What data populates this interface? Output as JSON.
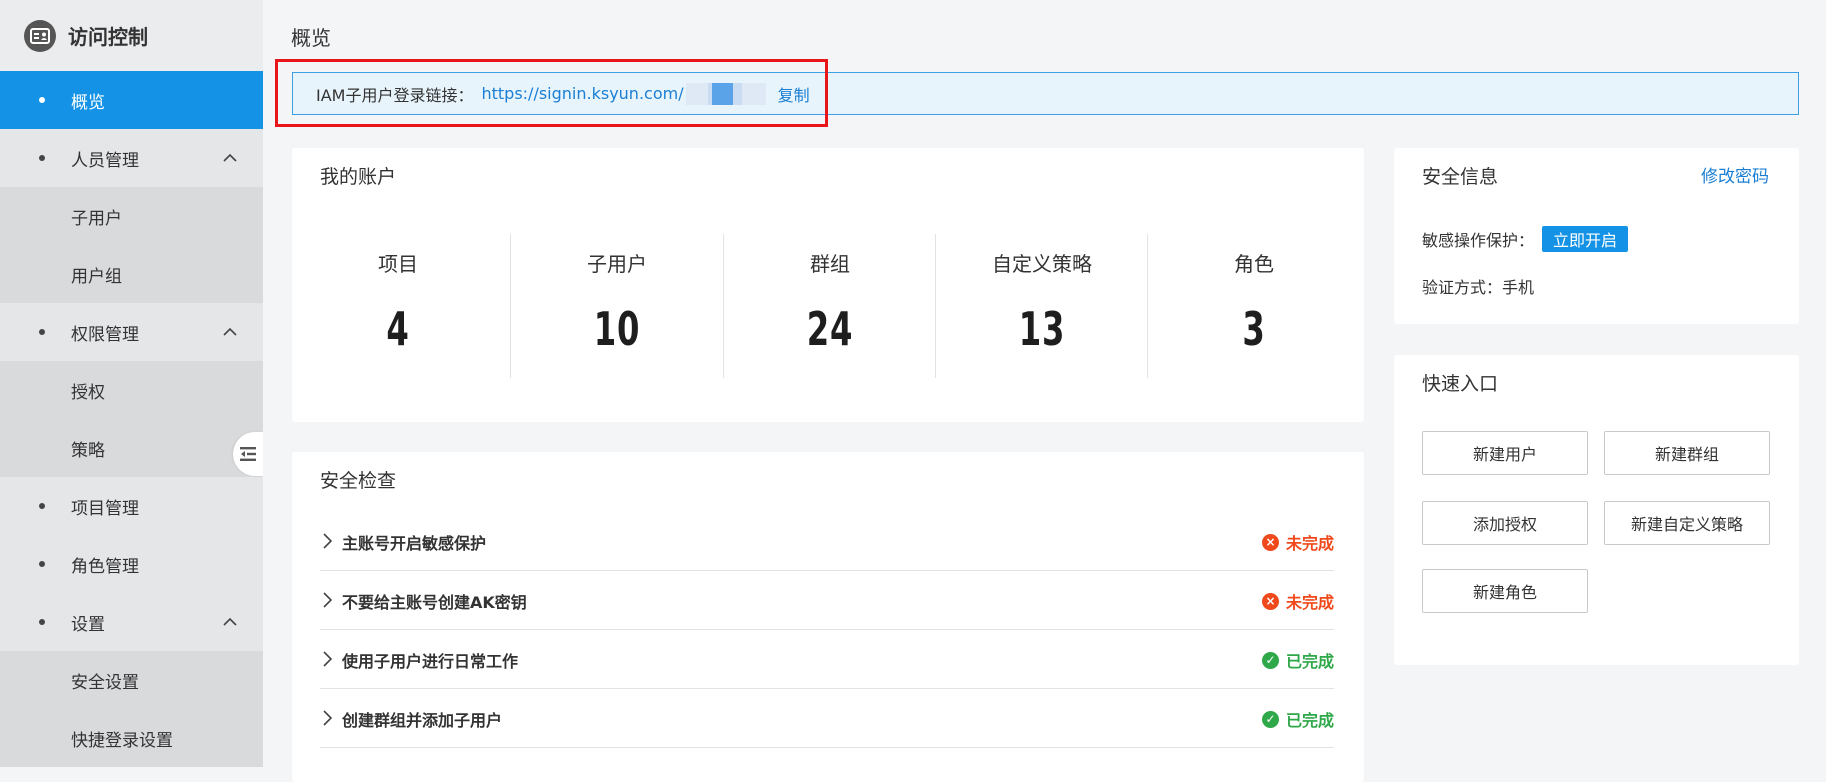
{
  "sidebar": {
    "brand": "访问控制",
    "items": [
      {
        "label": "概览"
      },
      {
        "label": "人员管理"
      },
      {
        "label": "子用户"
      },
      {
        "label": "用户组"
      },
      {
        "label": "权限管理"
      },
      {
        "label": "授权"
      },
      {
        "label": "策略"
      },
      {
        "label": "项目管理"
      },
      {
        "label": "角色管理"
      },
      {
        "label": "设置"
      },
      {
        "label": "安全设置"
      },
      {
        "label": "快捷登录设置"
      }
    ]
  },
  "main": {
    "title": "概览",
    "login_link": {
      "label": "IAM子用户登录链接：",
      "url": "https://signin.ksyun.com/",
      "copy": "复制"
    }
  },
  "account": {
    "title": "我的账户",
    "stats": [
      {
        "label": "项目",
        "value": "4"
      },
      {
        "label": "子用户",
        "value": "10"
      },
      {
        "label": "群组",
        "value": "24"
      },
      {
        "label": "自定义策略",
        "value": "13"
      },
      {
        "label": "角色",
        "value": "3"
      }
    ]
  },
  "security_check": {
    "title": "安全检查",
    "items": [
      {
        "label": "主账号开启敏感保护",
        "status": "未完成"
      },
      {
        "label": "不要给主账号创建AK密钥",
        "status": "未完成"
      },
      {
        "label": "使用子用户进行日常工作",
        "status": "已完成"
      },
      {
        "label": "创建群组并添加子用户",
        "status": "已完成"
      }
    ]
  },
  "security_info": {
    "title": "安全信息",
    "edit_password": "修改密码",
    "sensitive_label": "敏感操作保护：",
    "enable_now": "立即开启",
    "verify_method": "验证方式：手机"
  },
  "quick_entry": {
    "title": "快速入口",
    "buttons": [
      "新建用户",
      "新建群组",
      "添加授权",
      "新建自定义策略",
      "新建角色"
    ]
  },
  "colors": {
    "accent": "#1493e6",
    "incomplete": "#f04a1c",
    "complete": "#2fa84a",
    "highlight": "#e8161b"
  }
}
